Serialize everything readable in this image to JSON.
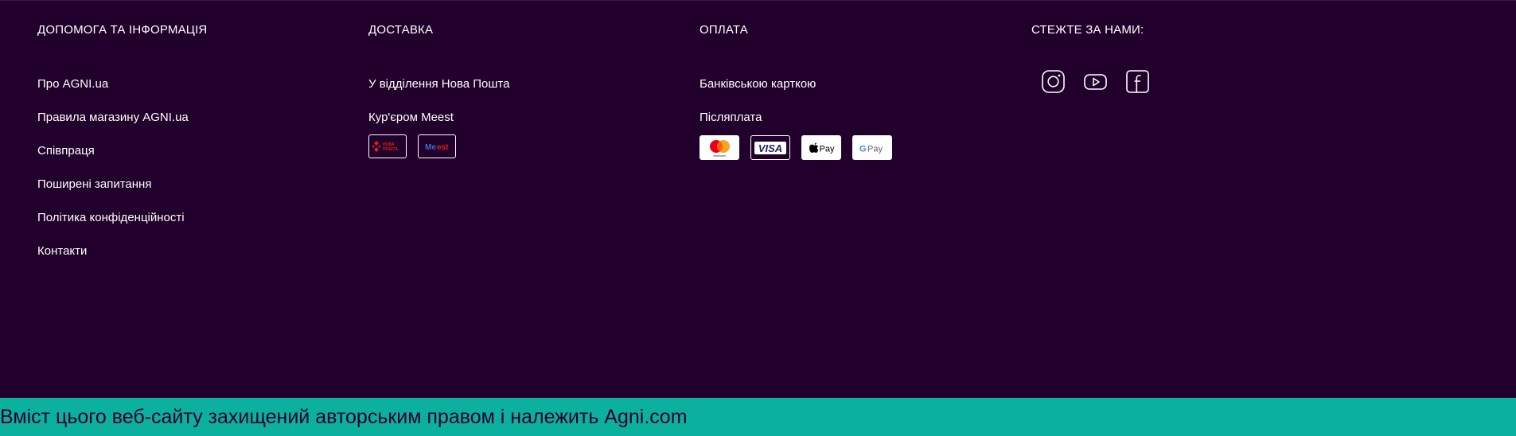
{
  "footer": {
    "help": {
      "title": "ДОПОМОГА ТА ІНФОРМАЦІЯ",
      "links": [
        {
          "label": "Про AGNI.ua"
        },
        {
          "label": "Правила магазину AGNI.ua"
        },
        {
          "label": "Співпраця"
        },
        {
          "label": "Поширені запитання"
        },
        {
          "label": "Політика конфіденційності"
        },
        {
          "label": "Контакти"
        }
      ]
    },
    "delivery": {
      "title": "ДОСТАВКА",
      "links": [
        {
          "label": "У відділення Нова Пошта"
        },
        {
          "label": "Кур'єром Meest"
        }
      ],
      "carriers": [
        {
          "name": "nova-poshta-logo",
          "text": "НОВА ПОШТА"
        },
        {
          "name": "meest-logo",
          "text": "Meest"
        }
      ]
    },
    "payment": {
      "title": "ОПЛАТА",
      "links": [
        {
          "label": "Банківською карткою"
        },
        {
          "label": "Післяплата"
        }
      ],
      "methods": [
        {
          "name": "mastercard-logo",
          "text": "mastercard"
        },
        {
          "name": "visa-logo",
          "text": "VISA"
        },
        {
          "name": "apple-pay-logo",
          "text": "Pay"
        },
        {
          "name": "google-pay-logo",
          "text": "Pay"
        }
      ]
    },
    "social": {
      "title": "СТЕЖТЕ ЗА НАМИ:",
      "icons": [
        "instagram-icon",
        "youtube-icon",
        "facebook-icon"
      ]
    }
  },
  "copyright": "Вміст цього веб-сайту захищений авторським правом і належить Agni.com",
  "colors": {
    "background": "#21012b",
    "accent_bar": "#0bb09f",
    "text": "#ffffff"
  }
}
